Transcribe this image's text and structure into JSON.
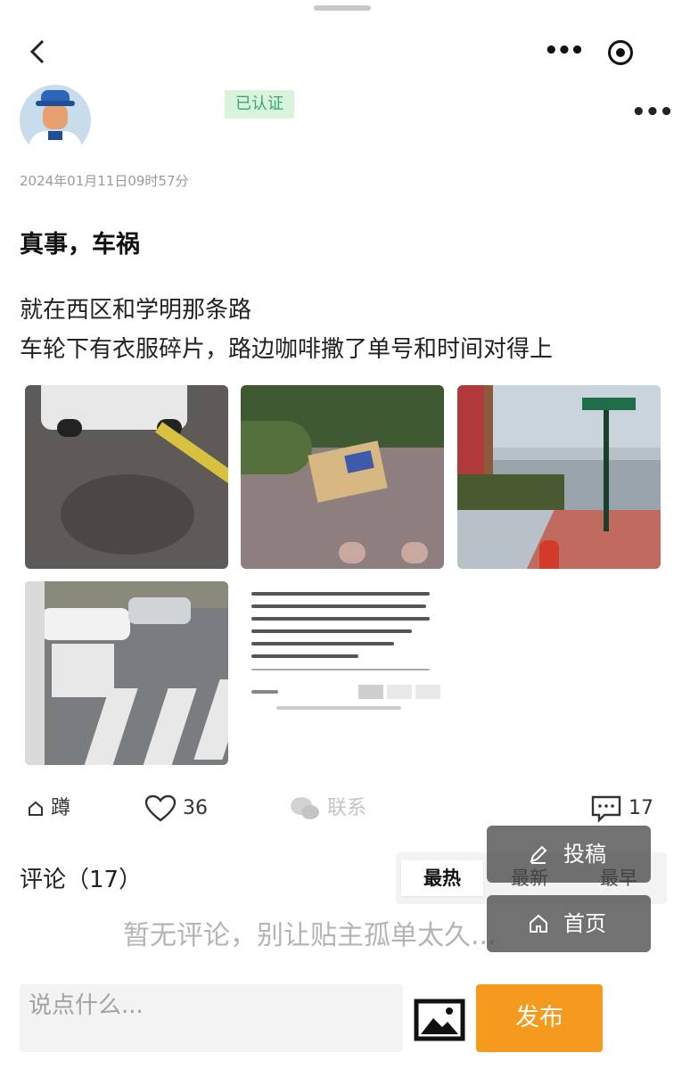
{
  "nav": {
    "back_glyph": "‹",
    "more_glyph": "•••"
  },
  "author": {
    "verified_badge": "已认证"
  },
  "post": {
    "timestamp": "2024年01月11日09时57分",
    "title": "真事，车祸",
    "body_lines": [
      "就在西区和学明那条路",
      "车轮下有衣服碎片，路边咖啡撒了单号和时间对得上"
    ],
    "more_glyph": "•••"
  },
  "actions": {
    "share_label": "蹲",
    "like_count": "36",
    "contact_label": "联系",
    "comment_count": "17"
  },
  "comments": {
    "title": "评论（17）",
    "sort_tabs": [
      "最热",
      "最新",
      "最早"
    ],
    "empty_text": "暂无评论，别让贴主孤单太久..."
  },
  "floating": {
    "post_label": "投稿",
    "home_label": "首页"
  },
  "composer": {
    "placeholder": "说点什么...",
    "publish_label": "发布"
  },
  "colors": {
    "accent_orange": "#f59a1c",
    "verified_green": "#39a86b",
    "verified_bg": "#d9f3dd"
  },
  "icons": [
    "back-icon",
    "more-icon",
    "target-icon",
    "share-icon",
    "heart-icon",
    "wechat-icon",
    "comment-icon",
    "pen-icon",
    "home-icon",
    "image-icon"
  ]
}
